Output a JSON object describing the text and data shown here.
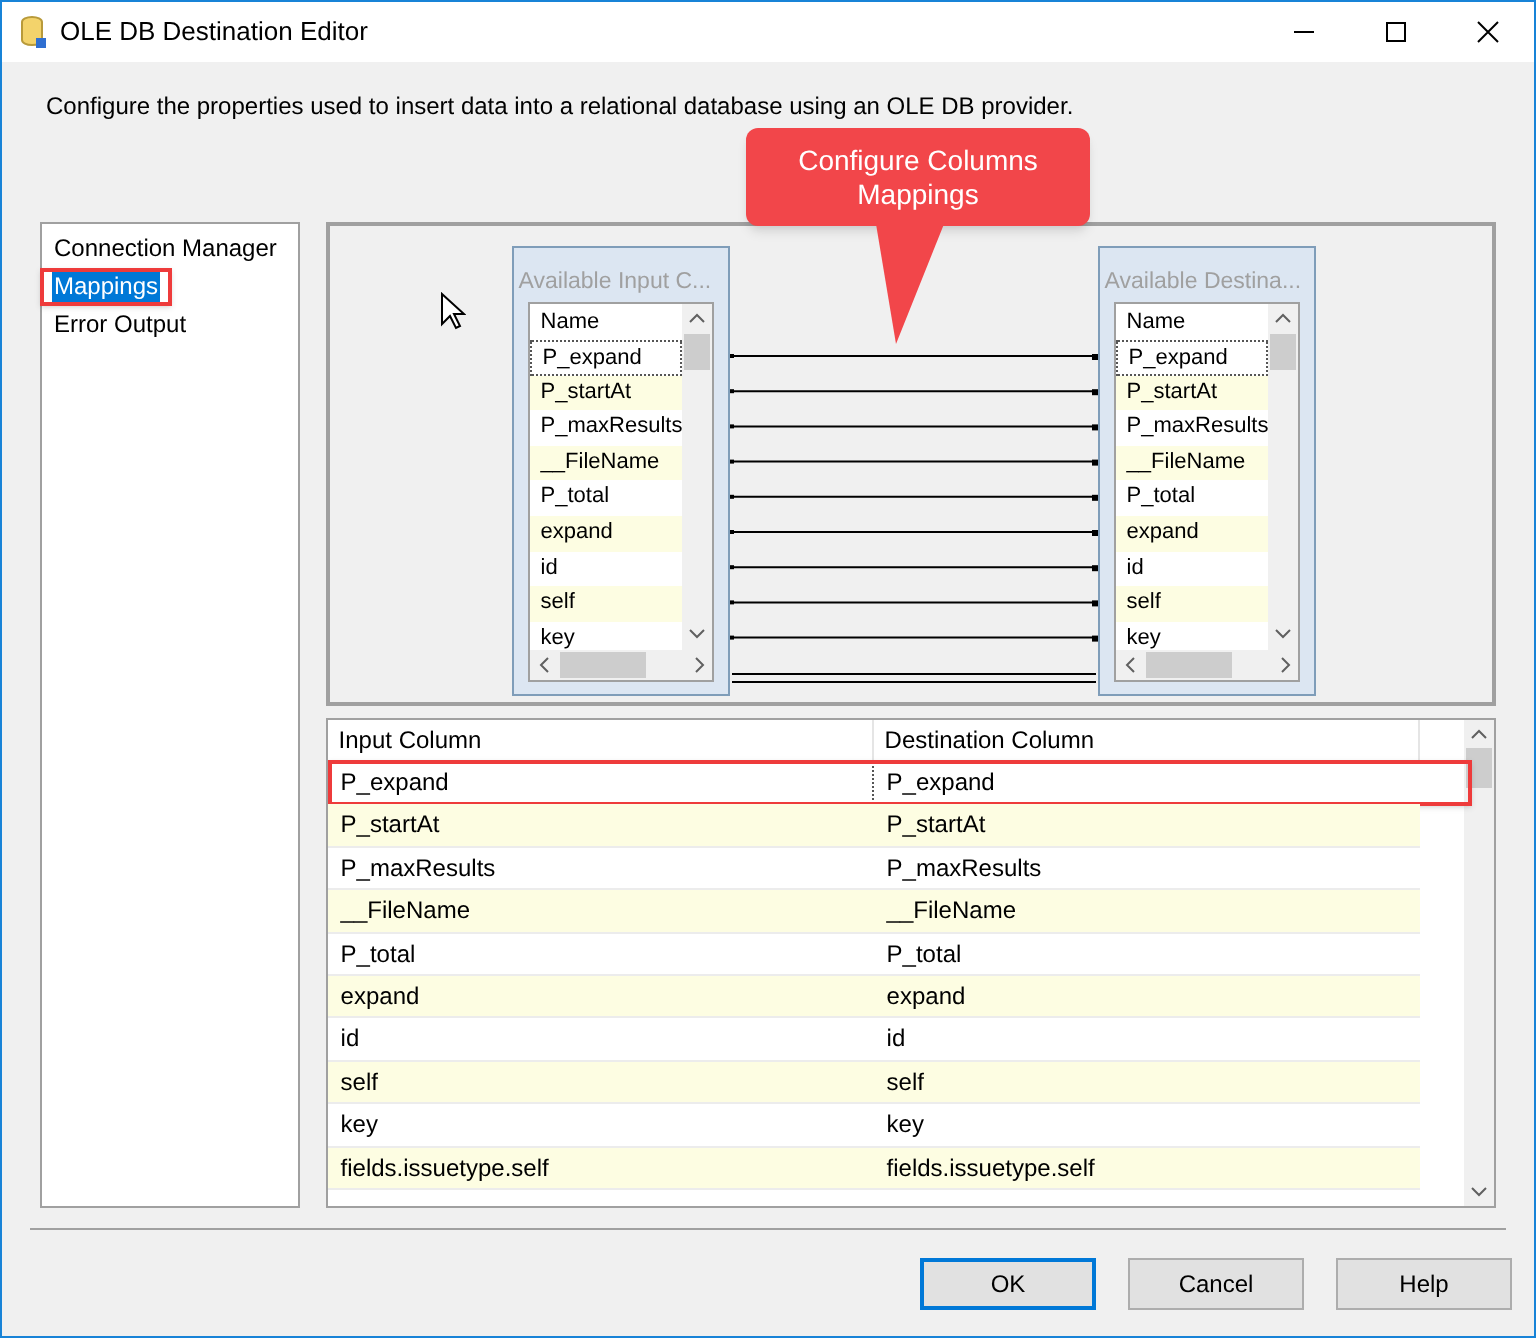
{
  "window": {
    "title": "OLE DB Destination Editor"
  },
  "description": "Configure the properties used to insert data into a relational database using an OLE DB provider.",
  "callout": {
    "text": "Configure Columns Mappings"
  },
  "sidebar": {
    "items": [
      {
        "label": "Connection Manager",
        "selected": false,
        "highlighted": false
      },
      {
        "label": "Mappings",
        "selected": true,
        "highlighted": true
      },
      {
        "label": "Error Output",
        "selected": false,
        "highlighted": false
      }
    ]
  },
  "input_columns": {
    "title": "Available Input C...",
    "header": "Name",
    "items": [
      "P_expand",
      "P_startAt",
      "P_maxResults",
      "__FileName",
      "P_total",
      "expand",
      "id",
      "self",
      "key"
    ]
  },
  "destination_columns": {
    "title": "Available Destina...",
    "header": "Name",
    "items": [
      "P_expand",
      "P_startAt",
      "P_maxResults",
      "__FileName",
      "P_total",
      "expand",
      "id",
      "self",
      "key"
    ]
  },
  "table": {
    "columns": [
      "Input Column",
      "Destination Column"
    ],
    "rows": [
      {
        "cells": [
          "P_expand",
          "P_expand"
        ],
        "highlighted": true
      },
      {
        "cells": [
          "P_startAt",
          "P_startAt"
        ],
        "highlighted": false
      },
      {
        "cells": [
          "P_maxResults",
          "P_maxResults"
        ],
        "highlighted": false
      },
      {
        "cells": [
          "__FileName",
          "__FileName"
        ],
        "highlighted": false
      },
      {
        "cells": [
          "P_total",
          "P_total"
        ],
        "highlighted": false
      },
      {
        "cells": [
          "expand",
          "expand"
        ],
        "highlighted": false
      },
      {
        "cells": [
          "id",
          "id"
        ],
        "highlighted": false
      },
      {
        "cells": [
          "self",
          "self"
        ],
        "highlighted": false
      },
      {
        "cells": [
          "key",
          "key"
        ],
        "highlighted": false
      },
      {
        "cells": [
          "fields.issuetype.self",
          "fields.issuetype.self"
        ],
        "highlighted": false
      }
    ]
  },
  "buttons": [
    {
      "label": "OK",
      "default": true
    },
    {
      "label": "Cancel",
      "default": false
    },
    {
      "label": "Help",
      "default": false
    }
  ]
}
